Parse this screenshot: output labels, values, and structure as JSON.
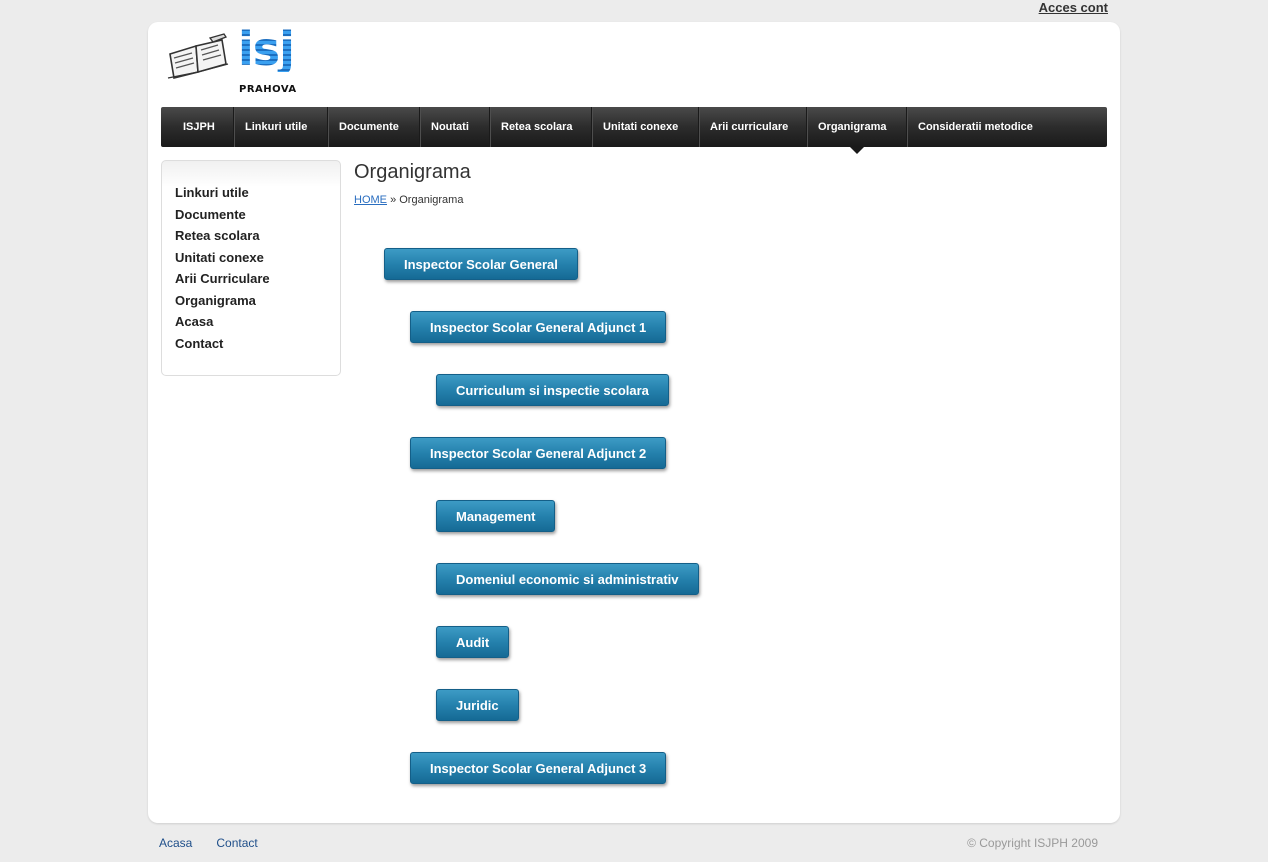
{
  "top_link": {
    "label": "Acces cont"
  },
  "logo": {
    "brand": "isj",
    "region": "PRAHOVA"
  },
  "nav": {
    "items": [
      {
        "label": "ISJPH"
      },
      {
        "label": "Linkuri utile"
      },
      {
        "label": "Documente"
      },
      {
        "label": "Noutati"
      },
      {
        "label": "Retea scolara"
      },
      {
        "label": "Unitati conexe"
      },
      {
        "label": "Arii curriculare"
      },
      {
        "label": "Organigrama",
        "active": true
      },
      {
        "label": "Consideratii metodice"
      }
    ]
  },
  "sidebar": {
    "items": [
      {
        "label": "Linkuri utile"
      },
      {
        "label": "Documente"
      },
      {
        "label": "Retea scolara"
      },
      {
        "label": "Unitati conexe"
      },
      {
        "label": "Arii Curriculare"
      },
      {
        "label": "Organigrama"
      },
      {
        "label": "Acasa"
      },
      {
        "label": "Contact"
      }
    ]
  },
  "main": {
    "title": "Organigrama",
    "breadcrumb": {
      "home": "HOME",
      "separator": "»",
      "current": "Organigrama"
    },
    "org_chart": [
      {
        "label": "Inspector Scolar General",
        "level": 0
      },
      {
        "label": "Inspector Scolar General Adjunct 1",
        "level": 1
      },
      {
        "label": "Curriculum si inspectie scolara",
        "level": 2
      },
      {
        "label": "Inspector Scolar General Adjunct 2",
        "level": 1
      },
      {
        "label": "Management",
        "level": 2
      },
      {
        "label": "Domeniul economic si administrativ",
        "level": 2
      },
      {
        "label": "Audit",
        "level": 2
      },
      {
        "label": "Juridic",
        "level": 2
      },
      {
        "label": "Inspector Scolar General Adjunct 3",
        "level": 1
      }
    ]
  },
  "footer": {
    "links": [
      {
        "label": "Acasa"
      },
      {
        "label": "Contact"
      }
    ],
    "copyright": "© Copyright ISJPH 2009"
  },
  "colors": {
    "page_bg": "#ececec",
    "nav_bg": "#2c2c2c",
    "button_blue": "#2581ad",
    "link_blue": "#2a6ec0",
    "logo_blue": "#2a8de0"
  }
}
